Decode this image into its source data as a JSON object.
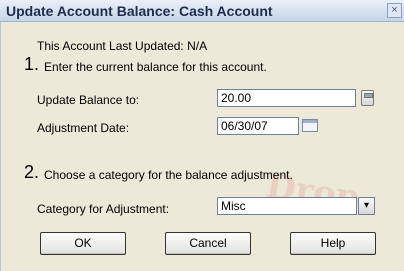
{
  "window": {
    "title": "Update Account Balance: Cash Account",
    "close_glyph": "×"
  },
  "info": {
    "last_updated": "This Account Last Updated: N/A"
  },
  "step1": {
    "number": "1.",
    "text": "Enter the current balance for this account.",
    "balance_label": "Update Balance to:",
    "balance_value": "20.00",
    "date_label": "Adjustment Date:",
    "date_value": "06/30/07"
  },
  "step2": {
    "number": "2.",
    "text": "Choose a category for the balance adjustment.",
    "category_label": "Category for Adjustment:",
    "category_value": "Misc",
    "dropdown_glyph": "▾"
  },
  "buttons": {
    "ok": "OK",
    "cancel": "Cancel",
    "help": "Help"
  },
  "watermark_text": "Drop",
  "icons": [
    "calculator-icon",
    "calendar-icon",
    "dropdown-arrow-icon",
    "close-icon"
  ]
}
